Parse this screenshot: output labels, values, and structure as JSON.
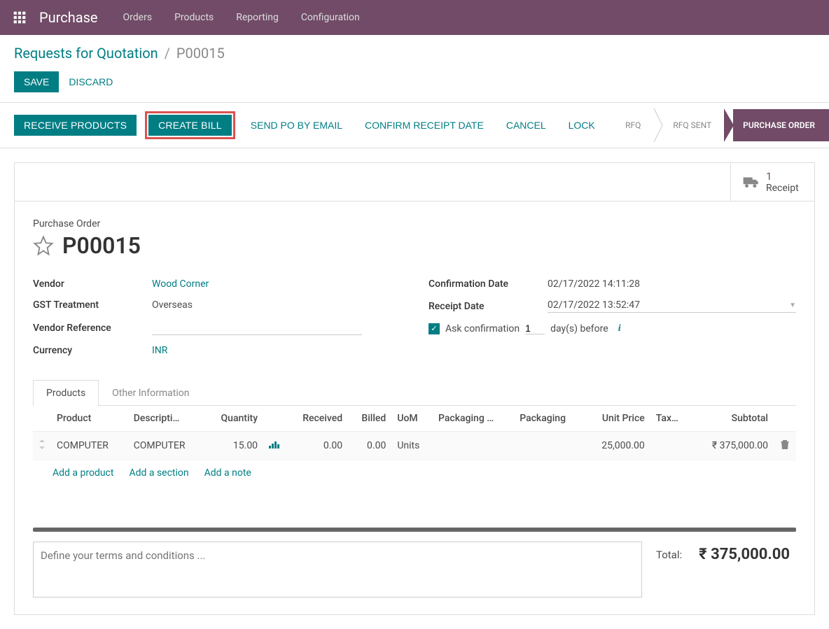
{
  "nav": {
    "brand": "Purchase",
    "items": [
      "Orders",
      "Products",
      "Reporting",
      "Configuration"
    ]
  },
  "breadcrumb": {
    "parent": "Requests for Quotation",
    "current": "P00015"
  },
  "buttons": {
    "save": "SAVE",
    "discard": "DISCARD"
  },
  "actions": {
    "receive": "RECEIVE PRODUCTS",
    "create_bill": "CREATE BILL",
    "send_po": "SEND PO BY EMAIL",
    "confirm_receipt": "CONFIRM RECEIPT DATE",
    "cancel": "CANCEL",
    "lock": "LOCK"
  },
  "status": {
    "rfq": "RFQ",
    "rfq_sent": "RFQ SENT",
    "purchase_order": "PURCHASE ORDER"
  },
  "stat": {
    "count": "1",
    "label": "Receipt"
  },
  "doc": {
    "type_label": "Purchase Order",
    "name": "P00015"
  },
  "fields": {
    "vendor": {
      "label": "Vendor",
      "value": "Wood Corner"
    },
    "gst": {
      "label": "GST Treatment",
      "value": "Overseas"
    },
    "vendor_ref": {
      "label": "Vendor Reference",
      "value": ""
    },
    "currency": {
      "label": "Currency",
      "value": "INR"
    },
    "confirmation": {
      "label": "Confirmation Date",
      "value": "02/17/2022 14:11:28"
    },
    "receipt": {
      "label": "Receipt Date",
      "value": "02/17/2022 13:52:47"
    },
    "ask": {
      "label": "Ask confirmation",
      "days": "1",
      "suffix": "day(s) before"
    }
  },
  "tabs": {
    "products": "Products",
    "other": "Other Information"
  },
  "table": {
    "headers": {
      "product": "Product",
      "description": "Descripti…",
      "quantity": "Quantity",
      "received": "Received",
      "billed": "Billed",
      "uom": "UoM",
      "pkg_qty": "Packaging …",
      "packaging": "Packaging",
      "unit_price": "Unit Price",
      "taxes": "Tax…",
      "subtotal": "Subtotal"
    },
    "row": {
      "product": "COMPUTER",
      "description": "COMPUTER",
      "quantity": "15.00",
      "received": "0.00",
      "billed": "0.00",
      "uom": "Units",
      "pkg_qty": "",
      "packaging": "",
      "unit_price": "25,000.00",
      "taxes": "",
      "subtotal": "₹ 375,000.00"
    },
    "addlinks": {
      "product": "Add a product",
      "section": "Add a section",
      "note": "Add a note"
    }
  },
  "terms_placeholder": "Define your terms and conditions ...",
  "totals": {
    "label": "Total:",
    "amount": "₹ 375,000.00"
  }
}
